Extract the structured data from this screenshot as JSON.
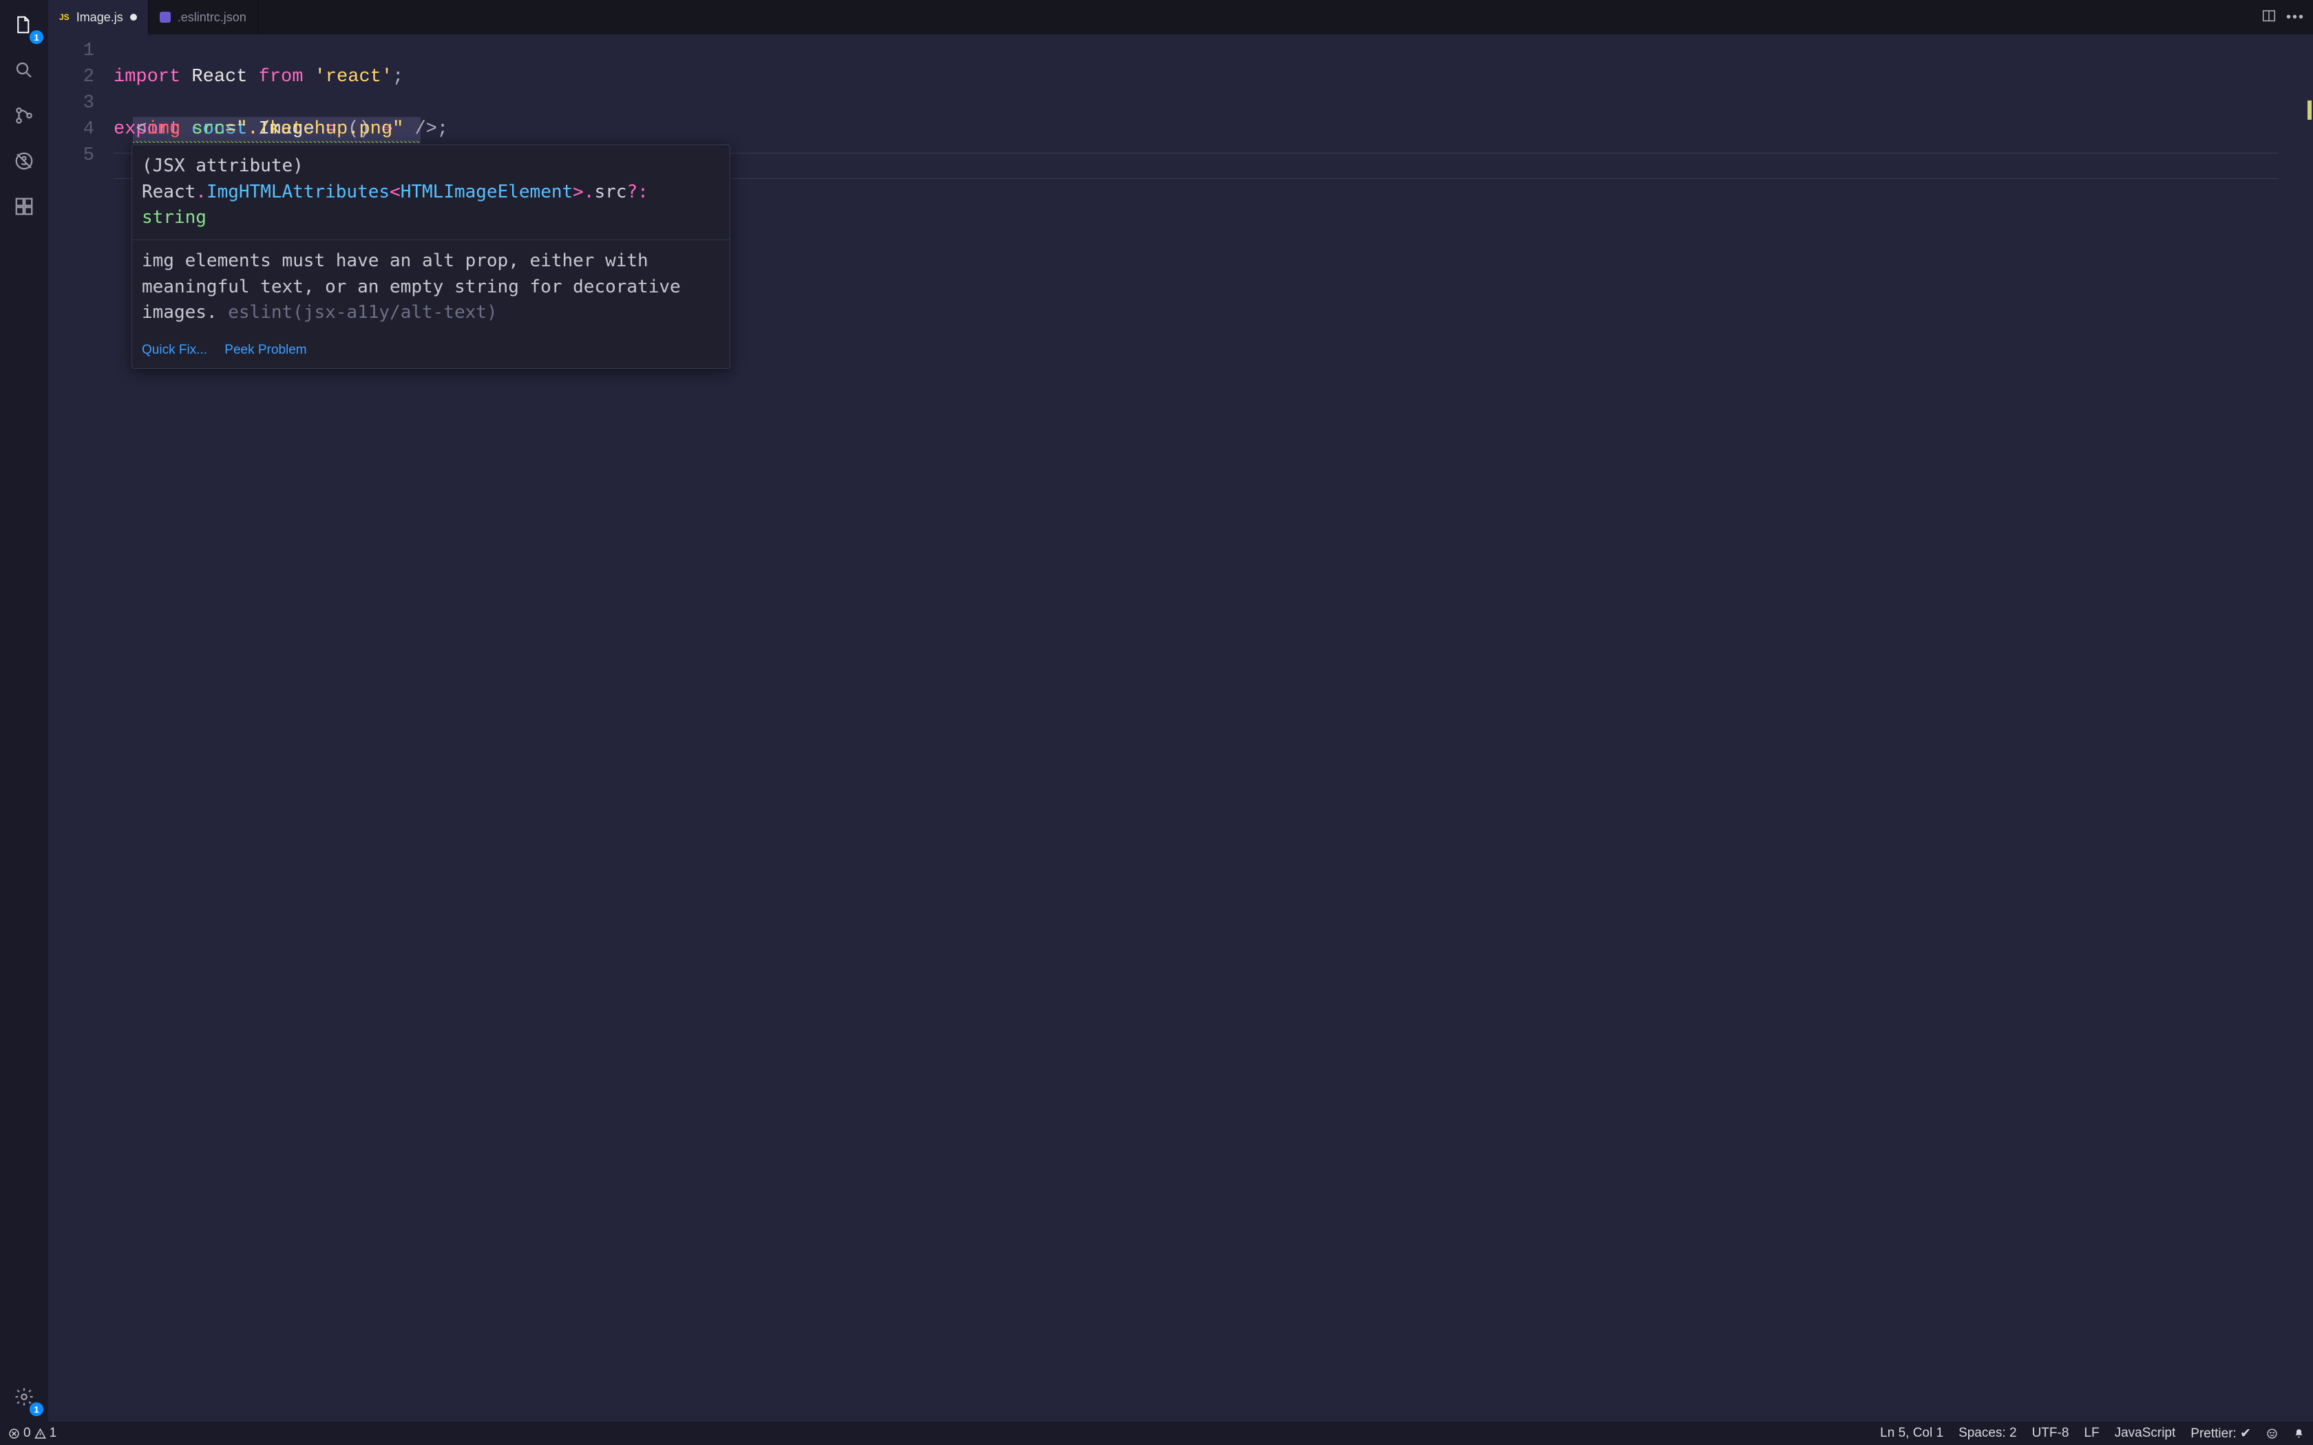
{
  "activityBar": {
    "items": [
      {
        "name": "explorer",
        "badge": "1"
      },
      {
        "name": "search"
      },
      {
        "name": "source-control"
      },
      {
        "name": "debug"
      },
      {
        "name": "extensions"
      }
    ],
    "settingsBadge": "1"
  },
  "tabs": [
    {
      "icon": "js",
      "label": "Image.js",
      "dirty": true,
      "active": true
    },
    {
      "icon": "eslint",
      "label": ".eslintrc.json",
      "dirty": false,
      "active": false
    }
  ],
  "editor": {
    "lines": [
      "1",
      "2",
      "3",
      "4",
      "5"
    ],
    "line1": {
      "import": "import",
      "react": "React",
      "from": "from",
      "str": "'react'",
      "semi": ";"
    },
    "line3": {
      "export": "export",
      "const": "const",
      "name": "Image",
      "eq": "=",
      "parens": "()",
      "arrow": "⇒"
    },
    "line4": {
      "lt": "<",
      "tag": "img",
      "attr": "src",
      "eqStr": "=\"./ketchup.png\"",
      "close": " />",
      "semi": ";"
    }
  },
  "hover": {
    "sigPrefix": "(JSX attribute) ",
    "sigReact": "React",
    "sigDot1": ".",
    "sigImgAttrs": "ImgHTMLAttributes",
    "sigAngleOpen": "<",
    "sigHtmlEl": "HTMLImageElement",
    "sigAngleClose": ">",
    "sigDot2": ".",
    "sigSrc": "src",
    "sigOpt": "?:",
    "sigSpace": " ",
    "sigString": "string",
    "message": "img elements must have an alt prop, either with meaningful text, or an empty string for decorative images.",
    "rule": "eslint(jsx-a11y/alt-text)",
    "quickFix": "Quick Fix...",
    "peekProblem": "Peek Problem"
  },
  "status": {
    "errors": "0",
    "warnings": "1",
    "cursor": "Ln 5, Col 1",
    "spaces": "Spaces: 2",
    "encoding": "UTF-8",
    "eol": "LF",
    "language": "JavaScript",
    "prettier": "Prettier: ✔"
  }
}
